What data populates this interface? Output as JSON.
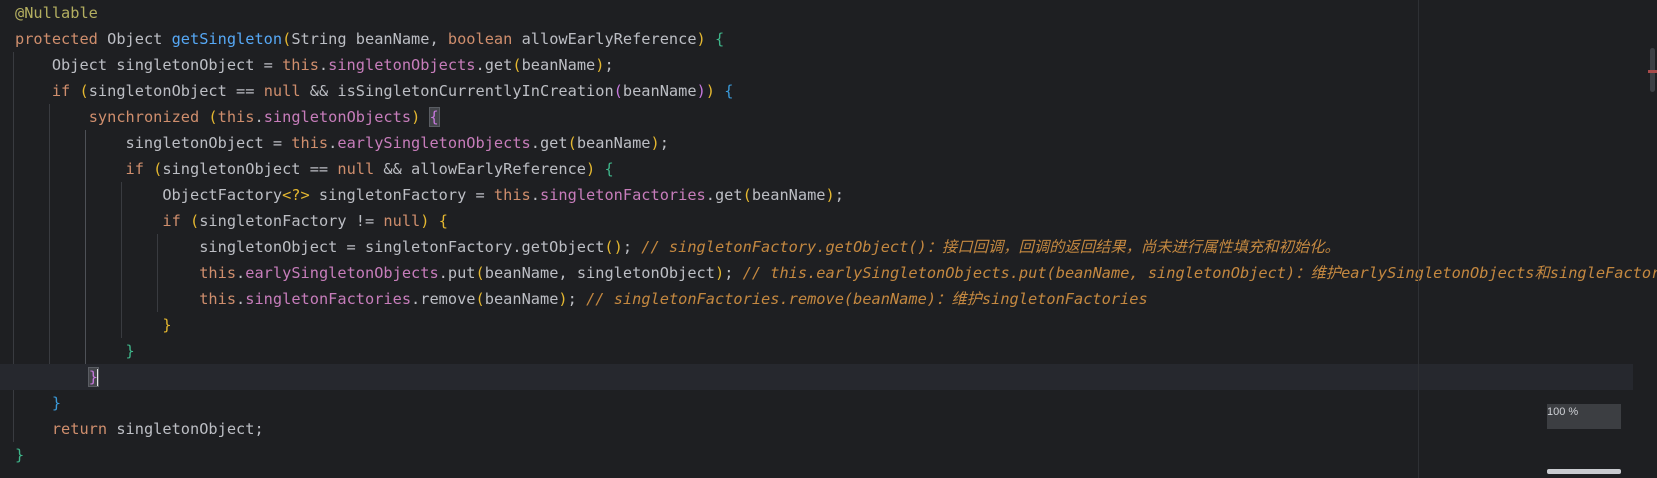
{
  "editor": {
    "zoom_label": "100 %",
    "lines": [
      {
        "tokens": [
          {
            "t": "@Nullable",
            "c": "ann"
          }
        ]
      },
      {
        "tokens": [
          {
            "t": "protected ",
            "c": "kw"
          },
          {
            "t": "Object "
          },
          {
            "t": "getSingleton",
            "c": "fn"
          },
          {
            "t": "(",
            "c": "p1"
          },
          {
            "t": "String beanName, "
          },
          {
            "t": "boolean ",
            "c": "kw"
          },
          {
            "t": "allowEarlyReference"
          },
          {
            "t": ")",
            "c": "p1"
          },
          {
            "t": " "
          },
          {
            "t": "{",
            "c": "p4"
          }
        ]
      },
      {
        "tokens": [
          {
            "t": "    Object singletonObject = "
          },
          {
            "t": "this",
            "c": "kw"
          },
          {
            "t": "."
          },
          {
            "t": "singletonObjects",
            "c": "fld"
          },
          {
            "t": ".get"
          },
          {
            "t": "(",
            "c": "p1"
          },
          {
            "t": "beanName"
          },
          {
            "t": ")",
            "c": "p1"
          },
          {
            "t": ";"
          }
        ]
      },
      {
        "tokens": [
          {
            "t": "    "
          },
          {
            "t": "if ",
            "c": "kw"
          },
          {
            "t": "(",
            "c": "p1"
          },
          {
            "t": "singletonObject == "
          },
          {
            "t": "null",
            "c": "kw"
          },
          {
            "t": " && isSingletonCurrentlyInCreation"
          },
          {
            "t": "(",
            "c": "p2"
          },
          {
            "t": "beanName"
          },
          {
            "t": ")",
            "c": "p2"
          },
          {
            "t": ")",
            "c": "p1"
          },
          {
            "t": " "
          },
          {
            "t": "{",
            "c": "p3"
          }
        ]
      },
      {
        "tokens": [
          {
            "t": "        "
          },
          {
            "t": "synchronized ",
            "c": "kw"
          },
          {
            "t": "(",
            "c": "p1"
          },
          {
            "t": "this",
            "c": "kw"
          },
          {
            "t": "."
          },
          {
            "t": "singletonObjects",
            "c": "fld"
          },
          {
            "t": ")",
            "c": "p1"
          },
          {
            "t": " "
          },
          {
            "t": "{",
            "c": "p2",
            "box": true
          }
        ]
      },
      {
        "tokens": [
          {
            "t": "            singletonObject = "
          },
          {
            "t": "this",
            "c": "kw"
          },
          {
            "t": "."
          },
          {
            "t": "earlySingletonObjects",
            "c": "fld"
          },
          {
            "t": ".get"
          },
          {
            "t": "(",
            "c": "p1"
          },
          {
            "t": "beanName"
          },
          {
            "t": ")",
            "c": "p1"
          },
          {
            "t": ";"
          }
        ]
      },
      {
        "tokens": [
          {
            "t": "            "
          },
          {
            "t": "if ",
            "c": "kw"
          },
          {
            "t": "(",
            "c": "p1"
          },
          {
            "t": "singletonObject == "
          },
          {
            "t": "null",
            "c": "kw"
          },
          {
            "t": " && allowEarlyReference"
          },
          {
            "t": ")",
            "c": "p1"
          },
          {
            "t": " "
          },
          {
            "t": "{",
            "c": "p4"
          }
        ]
      },
      {
        "tokens": [
          {
            "t": "                ObjectFactory"
          },
          {
            "t": "<?>",
            "c": "p1"
          },
          {
            "t": " singletonFactory = "
          },
          {
            "t": "this",
            "c": "kw"
          },
          {
            "t": "."
          },
          {
            "t": "singletonFactories",
            "c": "fld"
          },
          {
            "t": ".get"
          },
          {
            "t": "(",
            "c": "p1"
          },
          {
            "t": "beanName"
          },
          {
            "t": ")",
            "c": "p1"
          },
          {
            "t": ";"
          }
        ]
      },
      {
        "tokens": [
          {
            "t": "                "
          },
          {
            "t": "if ",
            "c": "kw"
          },
          {
            "t": "(",
            "c": "p1"
          },
          {
            "t": "singletonFactory != "
          },
          {
            "t": "null",
            "c": "kw"
          },
          {
            "t": ")",
            "c": "p1"
          },
          {
            "t": " "
          },
          {
            "t": "{",
            "c": "p1"
          }
        ]
      },
      {
        "tokens": [
          {
            "t": "                    singletonObject = singletonFactory.getObject"
          },
          {
            "t": "()",
            "c": "p1"
          },
          {
            "t": "; "
          },
          {
            "t": "// singletonFactory.getObject()：接口回调，回调的返回结果，尚未进行属性填充和初始化。",
            "c": "cmt"
          }
        ]
      },
      {
        "tokens": [
          {
            "t": "                    "
          },
          {
            "t": "this",
            "c": "kw"
          },
          {
            "t": "."
          },
          {
            "t": "earlySingletonObjects",
            "c": "fld"
          },
          {
            "t": ".put"
          },
          {
            "t": "(",
            "c": "p1"
          },
          {
            "t": "beanName, singletonObject"
          },
          {
            "t": ")",
            "c": "p1"
          },
          {
            "t": "; "
          },
          {
            "t": "// this.earlySingletonObjects.put(beanName, singletonObject)：维护earlySingletonObjects和singleFactories",
            "c": "cmt"
          }
        ]
      },
      {
        "tokens": [
          {
            "t": "                    "
          },
          {
            "t": "this",
            "c": "kw"
          },
          {
            "t": "."
          },
          {
            "t": "singletonFactories",
            "c": "fld"
          },
          {
            "t": ".remove"
          },
          {
            "t": "(",
            "c": "p1"
          },
          {
            "t": "beanName"
          },
          {
            "t": ")",
            "c": "p1"
          },
          {
            "t": "; "
          },
          {
            "t": "// singletonFactories.remove(beanName)：维护singletonFactories",
            "c": "cmt"
          }
        ]
      },
      {
        "tokens": [
          {
            "t": "                "
          },
          {
            "t": "}",
            "c": "p1"
          }
        ]
      },
      {
        "tokens": [
          {
            "t": "            "
          },
          {
            "t": "}",
            "c": "p4"
          }
        ]
      },
      {
        "tokens": [
          {
            "t": "        "
          },
          {
            "t": "}",
            "c": "p2",
            "box": true,
            "caret": true
          }
        ],
        "current": true
      },
      {
        "tokens": [
          {
            "t": "    "
          },
          {
            "t": "}",
            "c": "p3"
          }
        ]
      },
      {
        "tokens": [
          {
            "t": "    "
          },
          {
            "t": "return ",
            "c": "kw"
          },
          {
            "t": "singletonObject;"
          }
        ]
      },
      {
        "tokens": [
          {
            "t": "}",
            "c": "p4"
          }
        ]
      }
    ]
  }
}
